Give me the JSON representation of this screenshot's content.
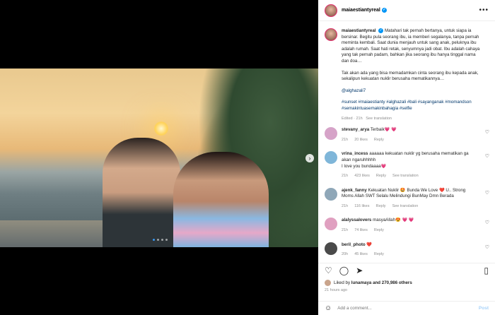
{
  "post": {
    "username": "maiaestiantyreal",
    "caption": {
      "p1": "Matahari tak pernah bertanya, untuk siapa ia bersinar. Begitu pula seorang ibu, ia memberi segalanya, tanpa pernah meminta kembali. Saat dunia menjauh untuk sang anak, peluknya ibu adalah rumah. Saat hati retak, senyumnya jadi obat. Ibu adalah cahaya yang tak pernah padam, bahkan jika seorang ibu hanya tinggal nama dan doa…",
      "p2": "Tak akan ada yang bisa memadamkan cinta seorang ibu kepada anak, sekalipun kekuatan nuklir berusaha mematikannya…",
      "mention": "@alghazali7",
      "hashtags": "#sunset #maiaestianty #alghazali #bali #sayanganak #momandson #semakintuasemakinbahagia #selfie",
      "edited": "Edited · 21h",
      "see_translation": "See translation"
    },
    "comments": [
      {
        "user": "stevany_arya",
        "text": "Terbaik💗 💗",
        "time": "21h",
        "likes": "20 likes",
        "reply": "Reply",
        "extra": "",
        "avatar_color": "#d6a3c8"
      },
      {
        "user": "vrina_incess",
        "text": "aaaaaa kekuatan nuklir yg berusaha mematikan ga akan ngaruhhhhh\nI love you bundaaaa💗",
        "time": "21h",
        "likes": "423 likes",
        "reply": "Reply",
        "extra": "See translation",
        "avatar_color": "#7fb6d9"
      },
      {
        "user": "ajenk_fanny",
        "text": "Kekuatan Nuklir 🤩 Bunda We Love ❤️ U.. Strong Moms Allah SWT Selalu Melindungi BunMay Dmn Berada",
        "time": "21h",
        "likes": "116 likes",
        "reply": "Reply",
        "extra": "See translation",
        "avatar_color": "#8fa7b8"
      },
      {
        "user": "alalyssalovers",
        "text": "masyaAllah😍 💗 💗",
        "time": "21h",
        "likes": "74 likes",
        "reply": "Reply",
        "extra": "",
        "avatar_color": "#e0a0c0"
      },
      {
        "user": "beril_photo",
        "text": "❤️",
        "time": "20h",
        "likes": "45 likes",
        "reply": "Reply",
        "extra": "",
        "avatar_color": "#4a4a4a"
      }
    ],
    "likes_text": "Liked by",
    "liked_by": "lunamaya",
    "likes_others": "and 270,986 others",
    "time_ago": "21 hours ago",
    "add_comment_placeholder": "Add a comment...",
    "post_label": "Post"
  },
  "icons": {
    "more": "•••",
    "heart": "♡",
    "comment": "◯",
    "share": "➤",
    "bookmark": "▯",
    "emoji": "☺",
    "next": "›",
    "verified": "✓"
  }
}
